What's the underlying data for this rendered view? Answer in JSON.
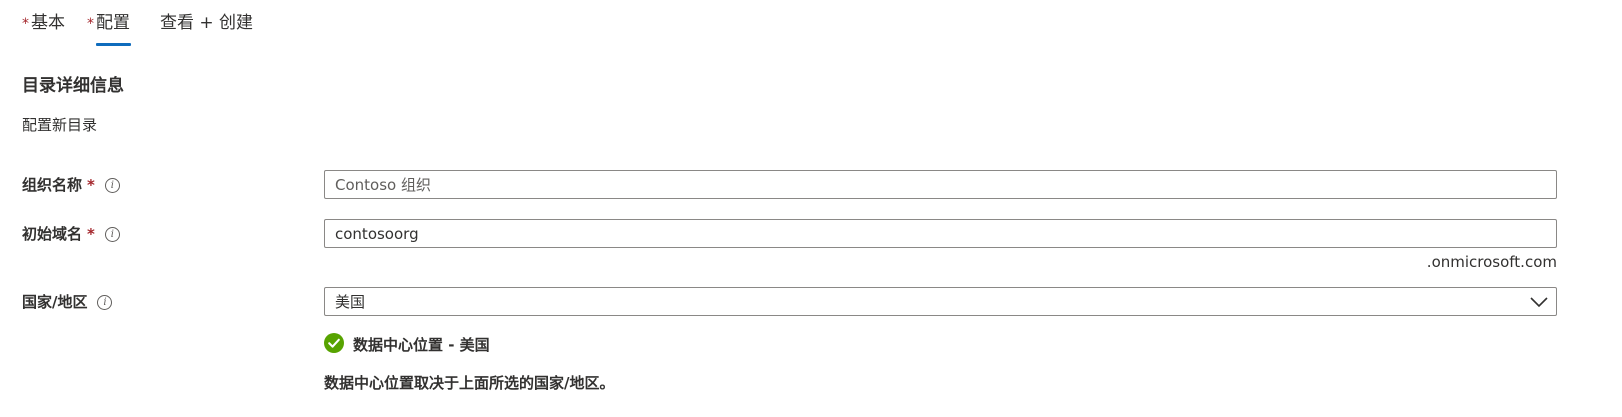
{
  "tabs": [
    {
      "label": "基本",
      "required": "*"
    },
    {
      "label": "配置",
      "required": "*",
      "active": true
    },
    {
      "label": "查看 + 创建"
    }
  ],
  "section": {
    "title": "目录详细信息",
    "description": "配置新目录"
  },
  "fields": {
    "org_name": {
      "label": "组织名称",
      "required": "*",
      "placeholder": "Contoso 组织",
      "value": ""
    },
    "domain": {
      "label": "初始域名",
      "required": "*",
      "value": "contosoorg",
      "suffix": ".onmicrosoft.com"
    },
    "country": {
      "label": "国家/地区",
      "selected": "美国"
    }
  },
  "datacenter": {
    "status": "数据中心位置 - 美国",
    "note": "数据中心位置取决于上面所选的国家/地区。"
  },
  "colors": {
    "accent": "#0f6cbd",
    "required": "#a4262c",
    "success": "#57a300",
    "text": "#323130",
    "border": "#8a8886"
  },
  "icons": {
    "info": "info-icon",
    "chevron": "chevron-down-icon",
    "success": "checkmark-circle-icon"
  }
}
